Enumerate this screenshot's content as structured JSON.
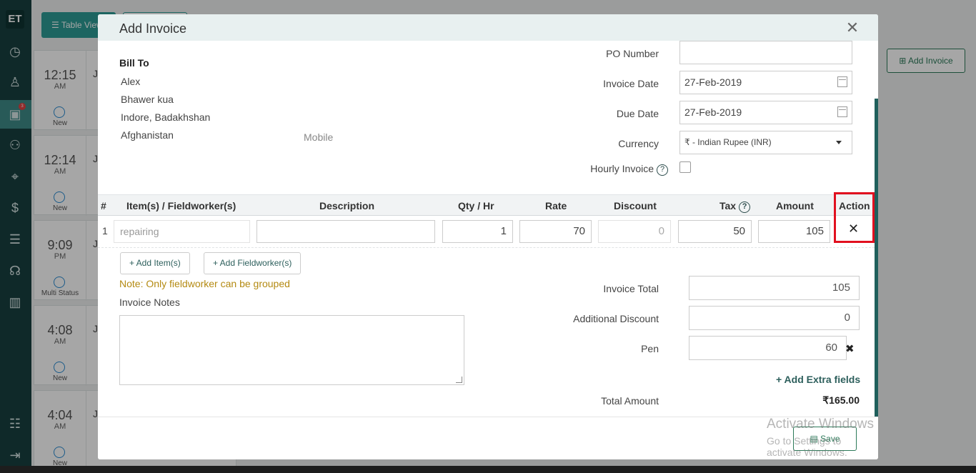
{
  "nav": {
    "logo": "ET",
    "badge": "3"
  },
  "background": {
    "table_view_label": "Table View",
    "add_invoice_label": "Add Invoice",
    "cards": [
      {
        "time": "12:15",
        "ampm": "AM",
        "status": "New",
        "name": "Ji"
      },
      {
        "time": "12:14",
        "ampm": "AM",
        "status": "New",
        "name": "Ji"
      },
      {
        "time": "9:09",
        "ampm": "PM",
        "status": "Multi Status",
        "name": "Ji"
      },
      {
        "time": "4:08",
        "ampm": "AM",
        "status": "New",
        "name": "Ji"
      },
      {
        "time": "4:04",
        "ampm": "AM",
        "status": "New",
        "name": "Ji"
      }
    ]
  },
  "modal": {
    "title": "Add Invoice",
    "bill_to": {
      "heading": "Bill To",
      "lines": [
        "Alex",
        "Bhawer kua",
        "Indore, Badakhshan",
        "Afghanistan"
      ],
      "mobile_label": "Mobile"
    },
    "form": {
      "po_number_label": "PO Number",
      "po_number_value": "",
      "invoice_date_label": "Invoice Date",
      "invoice_date_value": "27-Feb-2019",
      "due_date_label": "Due Date",
      "due_date_value": "27-Feb-2019",
      "currency_label": "Currency",
      "currency_value": "₹ - Indian Rupee (INR)",
      "hourly_label": "Hourly Invoice"
    },
    "table": {
      "headers": [
        "#",
        "Item(s) / Fieldworker(s)",
        "Description",
        "Qty / Hr",
        "Rate",
        "Discount",
        "Tax",
        "Amount",
        "Action"
      ],
      "row": {
        "index": "1",
        "item_placeholder": "repairing",
        "description": "",
        "qty": "1",
        "rate": "70",
        "discount_placeholder": "0",
        "tax": "50",
        "amount": "105",
        "action_symbol": "✕"
      }
    },
    "buttons": {
      "add_items": "+ Add Item(s)",
      "add_fieldworkers": "+ Add Fieldworker(s)",
      "add_extra": "+ Add Extra fields",
      "save": "Save"
    },
    "note": "Note: Only fieldworker can be grouped",
    "invoice_notes_label": "Invoice Notes",
    "totals": {
      "invoice_total_label": "Invoice Total",
      "invoice_total_value": "105",
      "additional_discount_label": "Additional Discount",
      "additional_discount_value": "0",
      "pen_label": "Pen",
      "pen_value": "60",
      "remove_symbol": "✖",
      "total_amount_label": "Total Amount",
      "total_amount_value": "₹165.00"
    }
  },
  "watermark": {
    "line1": "Activate Windows",
    "line2": "Go to Settings to activate Windows."
  }
}
